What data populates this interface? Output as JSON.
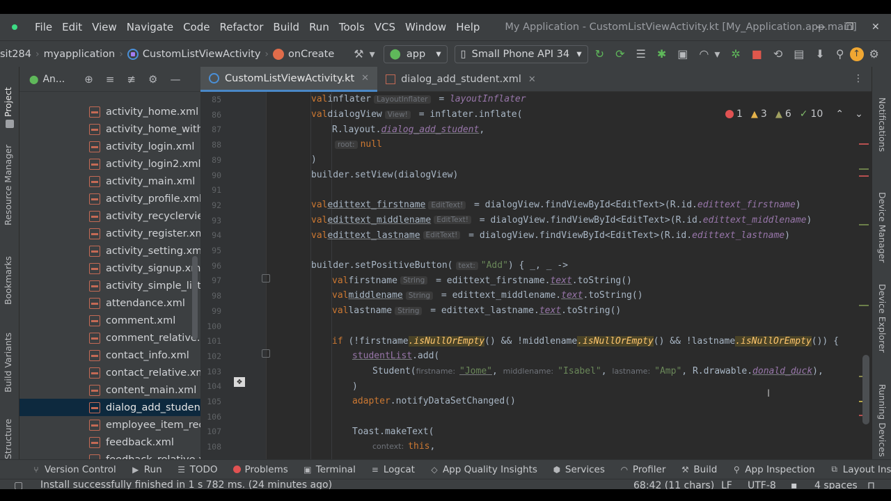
{
  "menubar": {
    "items": [
      "File",
      "Edit",
      "View",
      "Navigate",
      "Code",
      "Refactor",
      "Build",
      "Run",
      "Tools",
      "VCS",
      "Window",
      "Help"
    ],
    "title": "My Application - CustomListViewActivity.kt [My_Application.app.main]"
  },
  "navbar": {
    "crumb_root": "sit284",
    "crumb_module": "myapplication",
    "crumb_class": "CustomListViewActivity",
    "crumb_method": "onCreate",
    "config": "app",
    "device": "Small Phone API 34"
  },
  "project": {
    "title": "An...",
    "files": [
      "activity_home.xml",
      "activity_home_with_fr",
      "activity_login.xml",
      "activity_login2.xml",
      "activity_main.xml",
      "activity_profile.xml",
      "activity_recyclerview.",
      "activity_register.xml",
      "activity_setting.xml",
      "activity_signup.xml",
      "activity_simple_listvie",
      "attendance.xml",
      "comment.xml",
      "comment_relative.xm",
      "contact_info.xml",
      "contact_relative.xml",
      "content_main.xml",
      "dialog_add_student.x",
      "employee_item_recyc",
      "feedback.xml",
      "feedback_relative.xm"
    ],
    "selected_index": 17
  },
  "left_tools": [
    "Project",
    "Resource Manager",
    "Bookmarks",
    "Build Variants",
    "Structure"
  ],
  "right_tools": [
    "Notifications",
    "Device Manager",
    "Device Explorer",
    "Running Devices"
  ],
  "tabs": [
    {
      "label": "CustomListViewActivity.kt",
      "active": true
    },
    {
      "label": "dialog_add_student.xml",
      "active": false
    }
  ],
  "inspections": {
    "errors": "1",
    "warnings": "3",
    "weak": "6",
    "ok": "10"
  },
  "editor": {
    "line_numbers": [
      "85",
      "86",
      "87",
      "88",
      "89",
      "90",
      "91",
      "92",
      "93",
      "94",
      "95",
      "96",
      "97",
      "98",
      "99",
      "100",
      "101",
      "102",
      "103",
      "104",
      "105",
      "106",
      "107",
      "108"
    ],
    "hints": {
      "layout_inflater": "LayoutInflater",
      "view": "View!",
      "root": "root:",
      "edit_text": "EditText!",
      "text": "text:",
      "string": "String",
      "firstname": "firstname:",
      "middlename": "middlename:",
      "lastname": "lastname:",
      "context": "context:"
    },
    "tokens": {
      "val": "val",
      "inflater": "inflater",
      "eq": " = ",
      "layoutInflater": "layoutInflater",
      "dialogView": "dialogView",
      "inflate_call": "inflater.inflate(",
      "rlayout": "R.layout.",
      "dialog_add_student": "dialog_add_student",
      "comma": ",",
      "null": "null",
      "close_paren": ")",
      "setView": "builder.setView(dialogView)",
      "edittext_firstname": "edittext_firstname",
      "edittext_middlename": "edittext_middlename",
      "edittext_lastname": "edittext_lastname",
      "find_call": "dialogView.findViewById<EditText>(R.id.",
      "rid_firstname": "edittext_firstname",
      "rid_middlename": "edittext_middlename",
      "rid_lastname": "edittext_lastname",
      "positive": "builder.setPositiveButton(",
      "add_str": "\"Add\"",
      "lambda": ") { _, _ ->",
      "firstname": "firstname",
      "middlename": "middlename",
      "lastname": "lastname",
      "eq_first": " = edittext_firstname.",
      "eq_middle": " = edittext_middlename.",
      "eq_last": " = edittext_lastname.",
      "text": "text",
      "tostring": ".toString()",
      "if_kw": "if",
      "if_open": " (!firstname",
      "isnull": ".isNullOrEmpty",
      "and_middle": "() && !middlename",
      "and_last": "() && !lastname",
      "if_close": "()) {",
      "studentList": "studentList",
      "add_call": ".add(",
      "student_call": "Student(",
      "jome": "\"Jome\"",
      "isabel": "\"Isabel\"",
      "amp": "\"Amp\"",
      "rdrawable": ", R.drawable.",
      "donald": "donald_duck",
      "end_call": "),",
      "adapter": "adapter",
      "notify": ".notifyDataSetChanged()",
      "toast": "Toast.makeText(",
      "this": "this",
      "sep": ", "
    }
  },
  "bottom_tools": [
    "Version Control",
    "Run",
    "TODO",
    "Problems",
    "Terminal",
    "Logcat",
    "App Quality Insights",
    "Services",
    "Profiler",
    "Build",
    "App Inspection",
    "Layout Inspecto"
  ],
  "status": {
    "message": "Install successfully finished in 1 s 782 ms. (24 minutes ago)",
    "position": "68:42 (11 chars)",
    "line_sep": "LF",
    "encoding": "UTF-8",
    "indent": "4 spaces"
  }
}
